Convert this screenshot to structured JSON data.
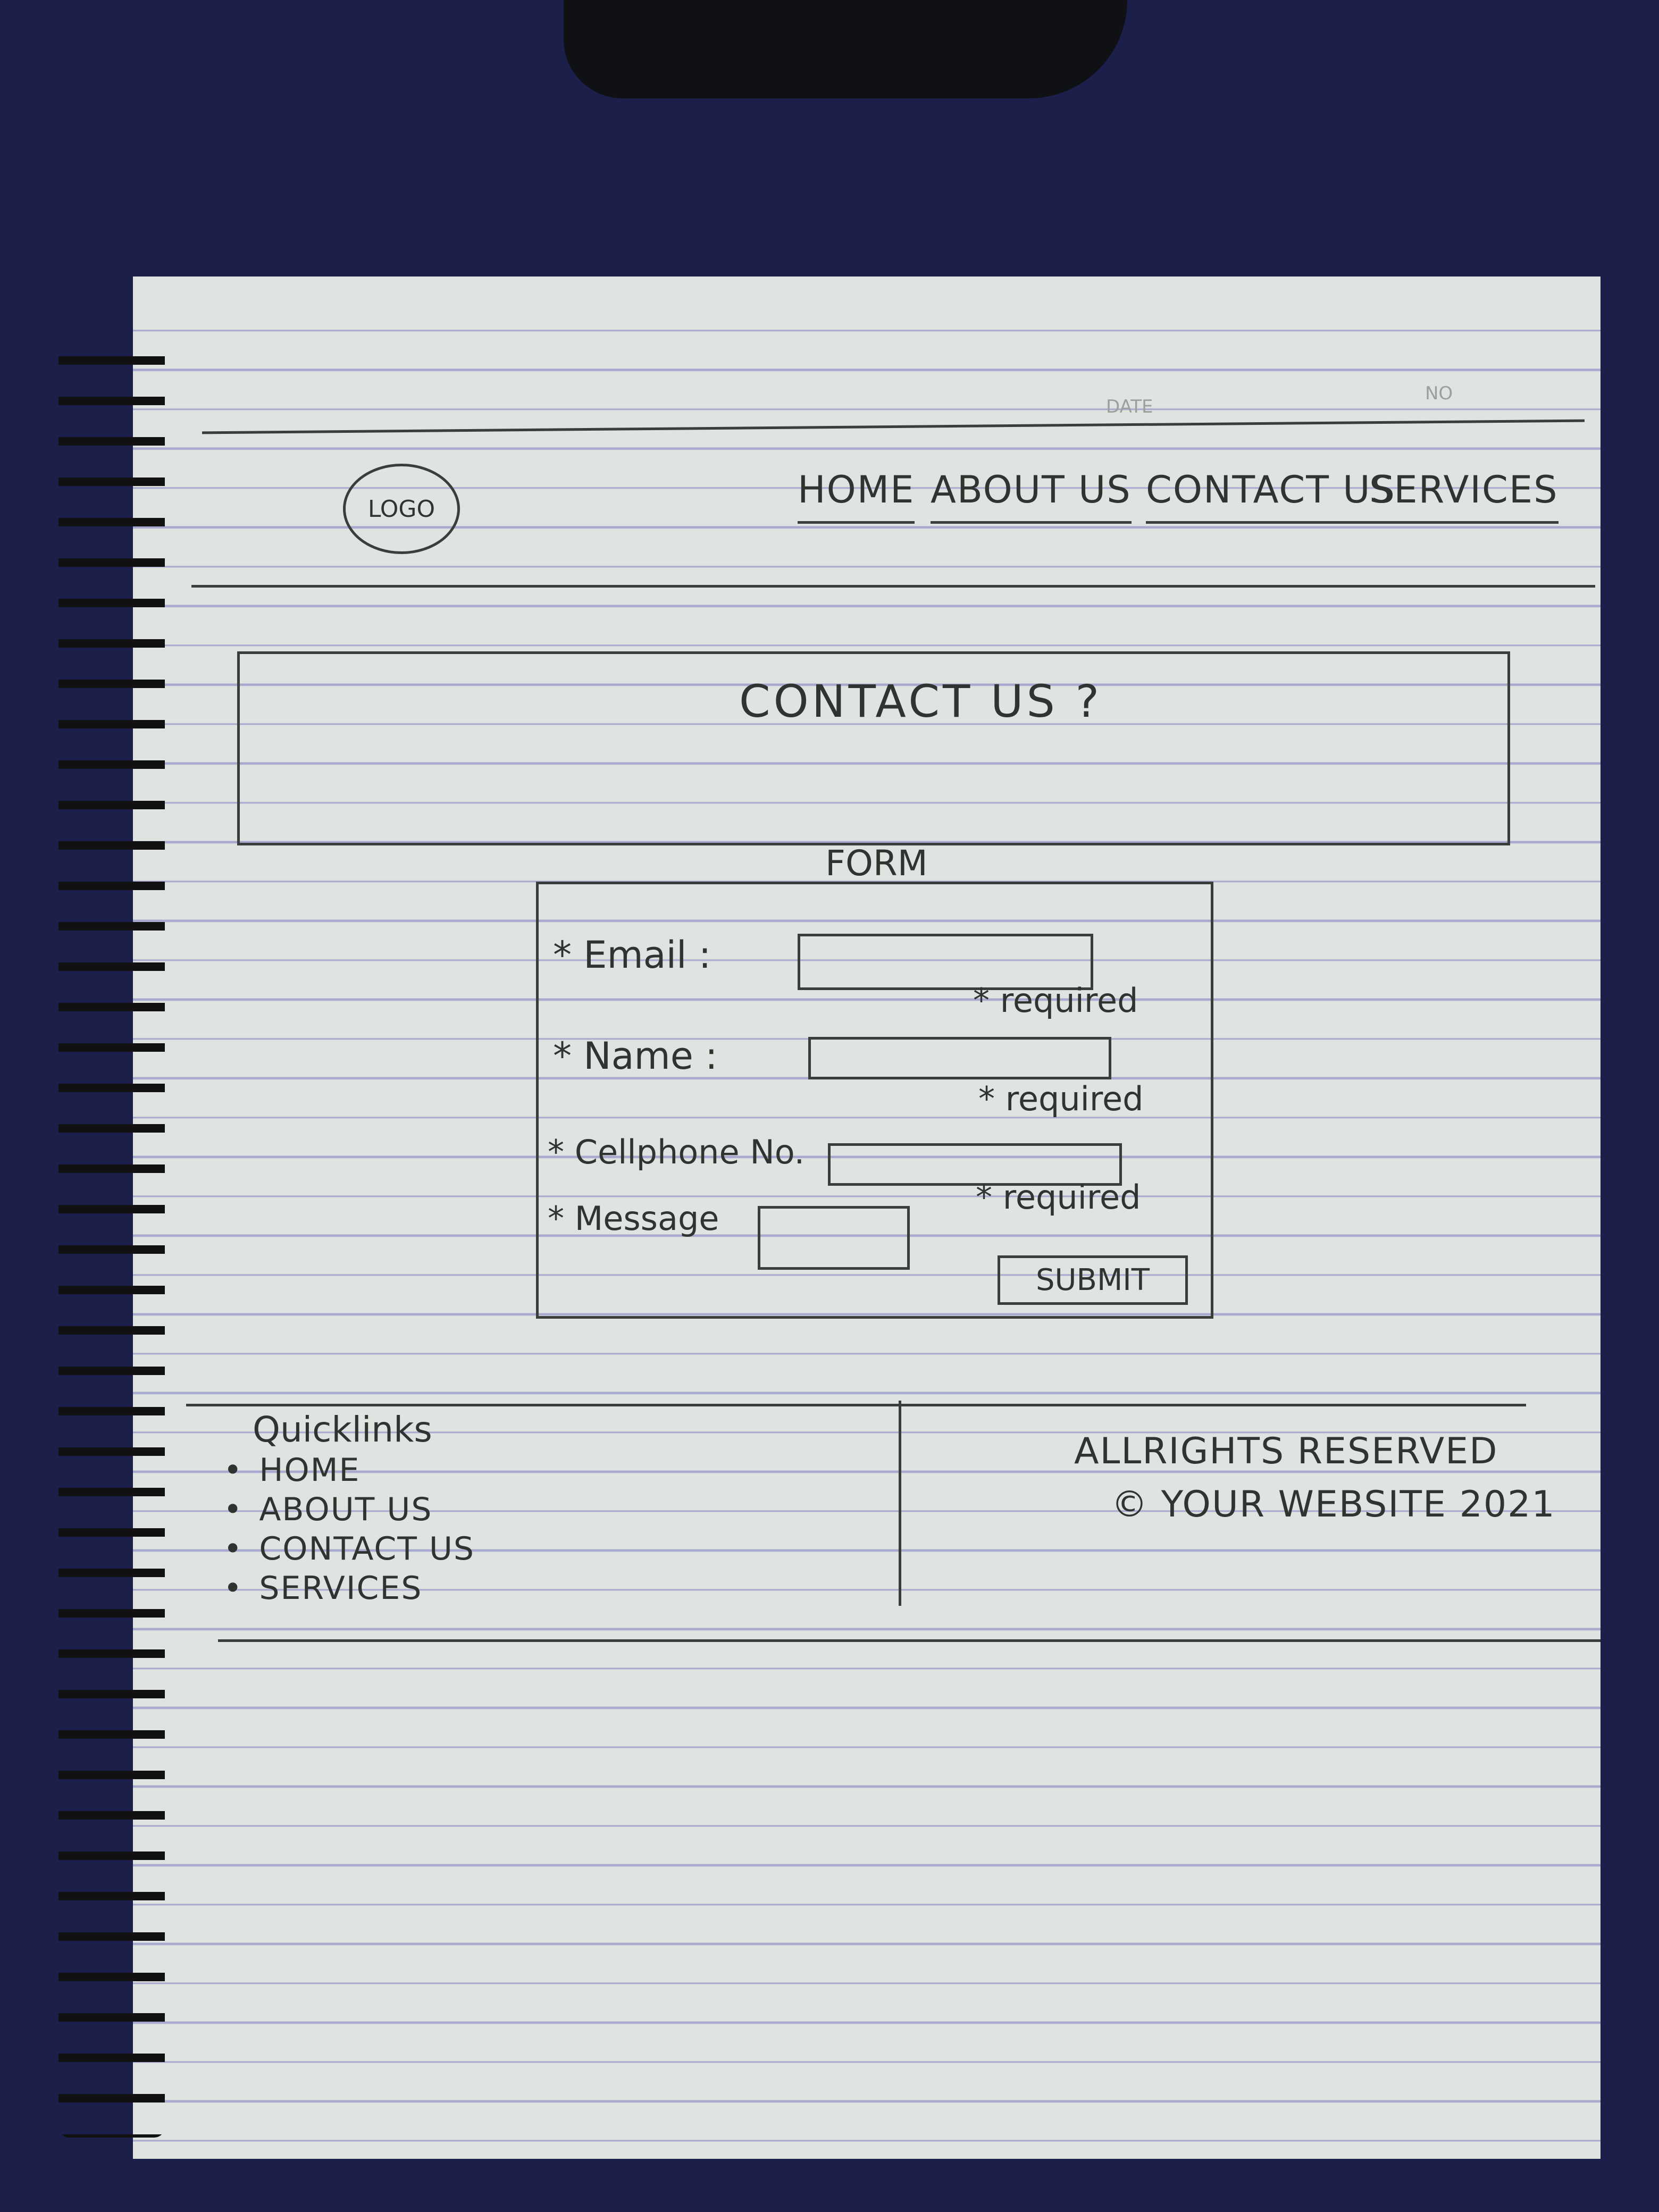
{
  "paper_header": {
    "date_label": "DATE",
    "no_label": "NO"
  },
  "header": {
    "logo": "LOGO",
    "nav": [
      {
        "label": "HOME"
      },
      {
        "label": "ABOUT US"
      },
      {
        "label": "CONTACT US"
      },
      {
        "label": "SERVICES"
      }
    ]
  },
  "hero": {
    "title": "CONTACT US ?"
  },
  "form": {
    "title": "FORM",
    "fields": [
      {
        "label": "* Email :",
        "required": "* required"
      },
      {
        "label": "* Name :",
        "required": "* required"
      },
      {
        "label": "* Cellphone No.",
        "required": "* required"
      },
      {
        "label": "* Message"
      }
    ],
    "submit": "SUBMIT"
  },
  "footer": {
    "quicklinks_title": "Quicklinks",
    "quicklinks": [
      "HOME",
      "ABOUT US",
      "CONTACT US",
      "SERVICES"
    ],
    "rights": "ALLRIGHTS RESERVED",
    "copyright": "© YOUR WEBSITE 2021"
  }
}
